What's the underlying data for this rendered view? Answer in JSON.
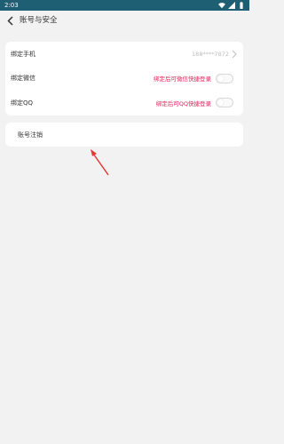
{
  "statusbar": {
    "time": "2:03",
    "icons": [
      "wifi-icon",
      "signal-icon",
      "battery-icon"
    ]
  },
  "header": {
    "title": "账号与安全"
  },
  "account_rows": [
    {
      "label": "绑定手机",
      "value": "188****7872"
    },
    {
      "label": "绑定微信",
      "hint": "绑定后可微信快捷登录"
    },
    {
      "label": "绑定QQ",
      "hint": "绑定后可QQ快捷登录"
    }
  ],
  "cancel_account": {
    "label": "账号注销"
  },
  "colors": {
    "statusbar": "#1e5f73",
    "accent": "#e0215a",
    "annotation": "#e53935"
  }
}
